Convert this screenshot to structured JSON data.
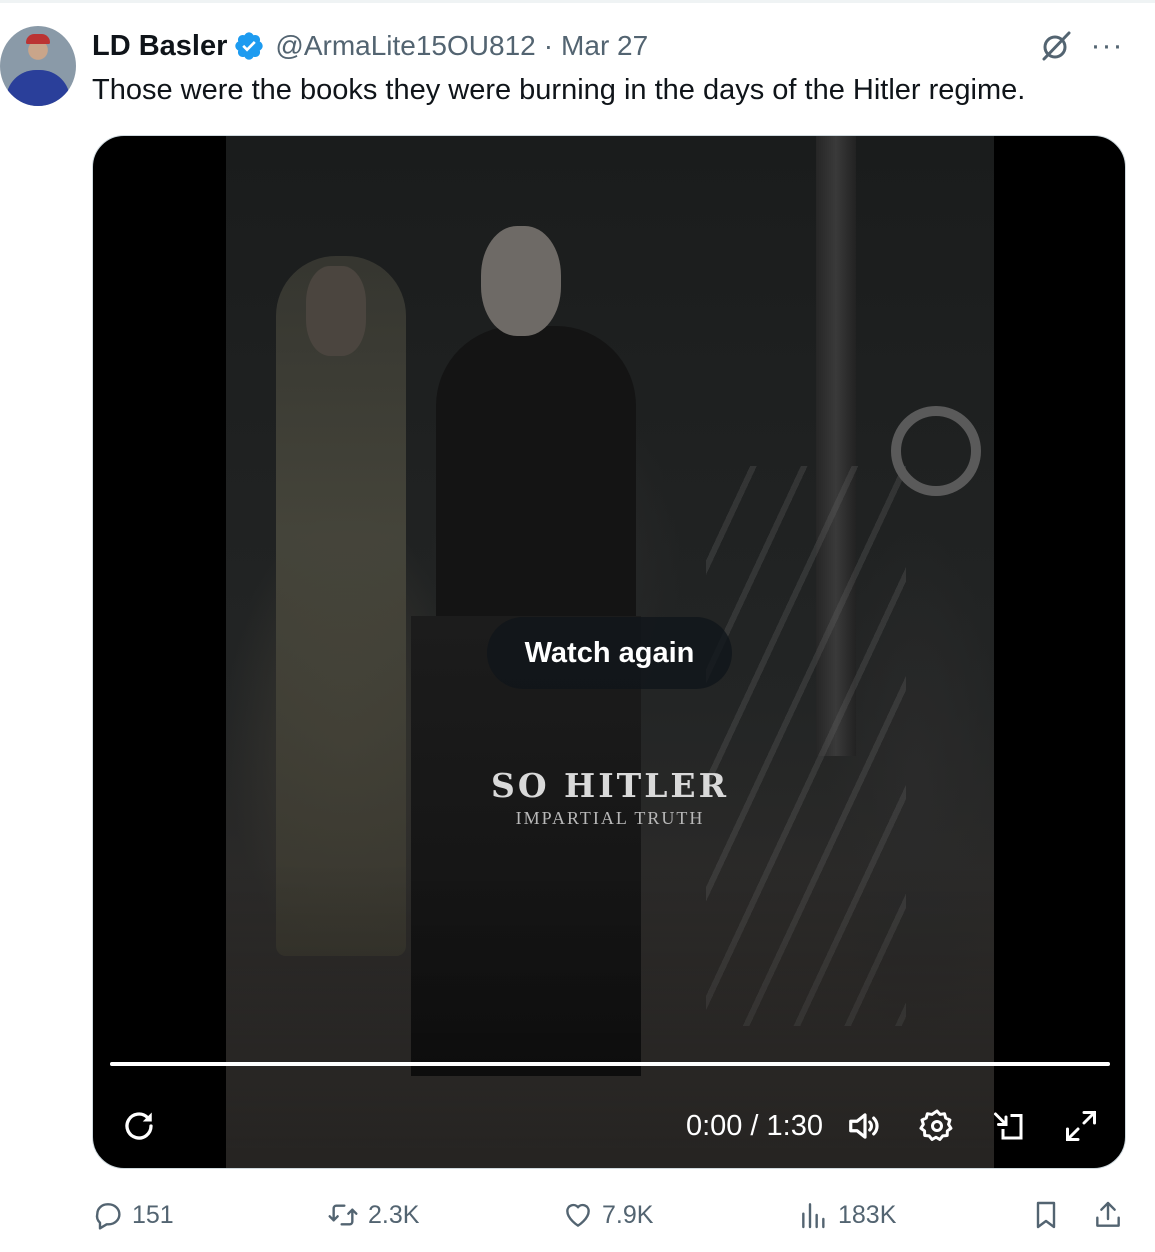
{
  "tweet": {
    "author_name": "LD Basler",
    "handle": "@ArmaLite15OU812",
    "separator": "·",
    "date": "Mar 27",
    "text": "Those were the books they were burning in the days of the Hitler regime.",
    "more_label": "···"
  },
  "video": {
    "overlay_button": "Watch again",
    "watermark_title": "SO HITLER",
    "watermark_subtitle": "IMPARTIAL TRUTH",
    "time_display": "0:00 / 1:30",
    "progress": 1.0
  },
  "actions": {
    "replies": "151",
    "reposts": "2.3K",
    "likes": "7.9K",
    "views": "183K"
  },
  "colors": {
    "verified_blue": "#1d9bf0",
    "secondary_text": "#536471",
    "primary_text": "#0f1419"
  },
  "icons": [
    "grok-icon",
    "more-icon",
    "replay-icon",
    "volume-icon",
    "settings-icon",
    "pip-icon",
    "fullscreen-icon",
    "reply-icon",
    "retweet-icon",
    "like-icon",
    "views-icon",
    "bookmark-icon",
    "share-icon",
    "verified-icon"
  ]
}
